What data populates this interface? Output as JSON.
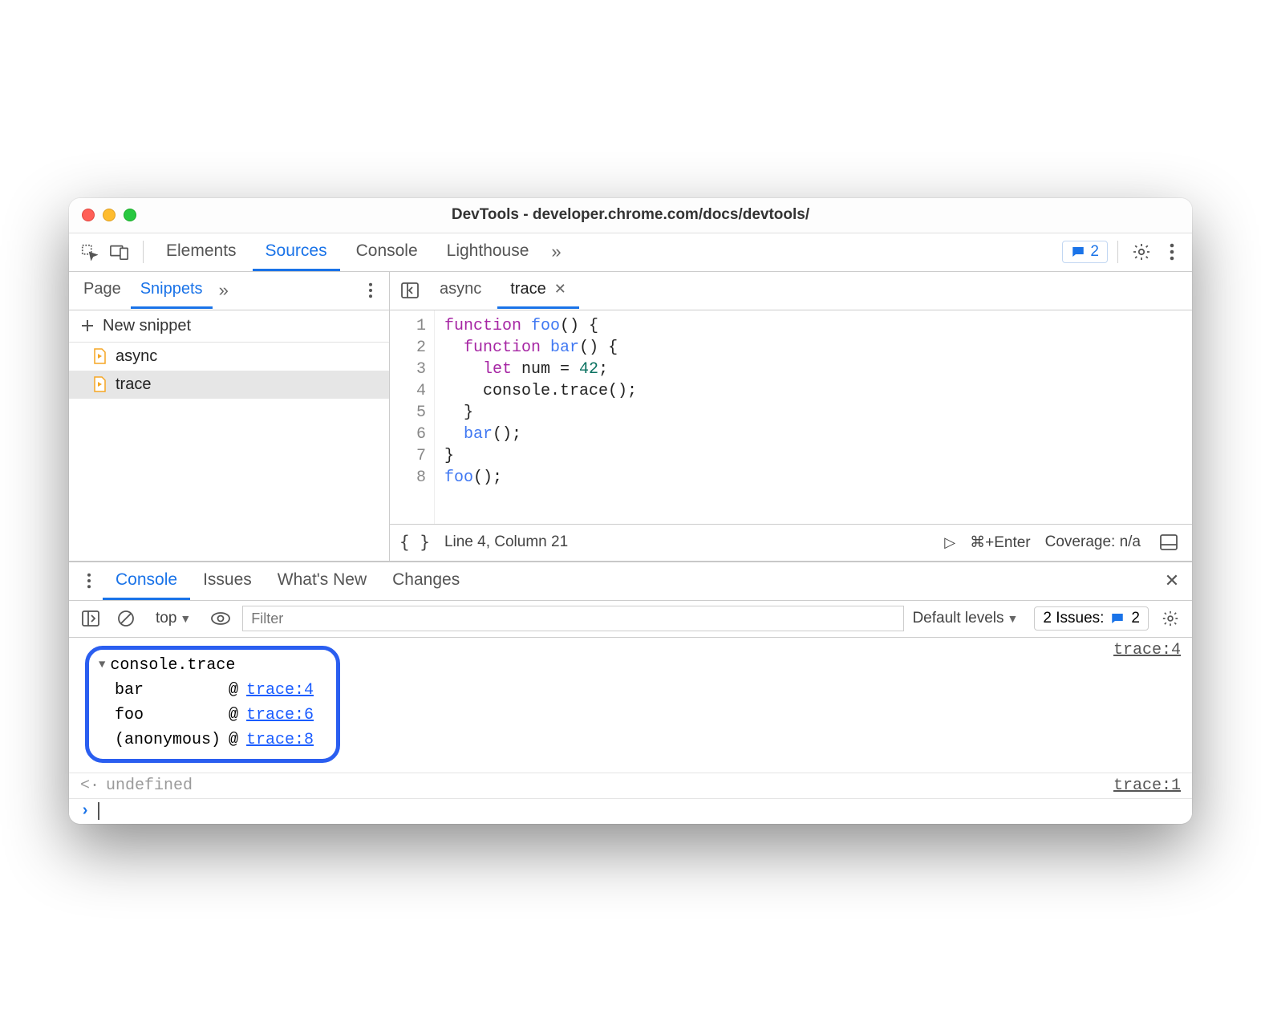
{
  "window": {
    "title": "DevTools - developer.chrome.com/docs/devtools/"
  },
  "toolbar": {
    "tabs": [
      "Elements",
      "Sources",
      "Console",
      "Lighthouse"
    ],
    "active_tab": "Sources",
    "issues_badge_count": "2"
  },
  "sidebar": {
    "tabs": [
      "Page",
      "Snippets"
    ],
    "active_tab": "Snippets",
    "new_snippet_label": "New snippet",
    "snippets": [
      {
        "name": "async",
        "selected": false
      },
      {
        "name": "trace",
        "selected": true
      }
    ]
  },
  "editor": {
    "tabs": [
      {
        "name": "async",
        "active": false,
        "closeable": false
      },
      {
        "name": "trace",
        "active": true,
        "closeable": true
      }
    ],
    "lines": [
      1,
      2,
      3,
      4,
      5,
      6,
      7,
      8
    ],
    "code_tokens": [
      [
        {
          "t": "kw",
          "s": "function"
        },
        {
          "t": "",
          "s": " "
        },
        {
          "t": "name",
          "s": "foo"
        },
        {
          "t": "",
          "s": "() {"
        }
      ],
      [
        {
          "t": "",
          "s": "  "
        },
        {
          "t": "kw",
          "s": "function"
        },
        {
          "t": "",
          "s": " "
        },
        {
          "t": "name",
          "s": "bar"
        },
        {
          "t": "",
          "s": "() {"
        }
      ],
      [
        {
          "t": "",
          "s": "    "
        },
        {
          "t": "kw",
          "s": "let"
        },
        {
          "t": "",
          "s": " num = "
        },
        {
          "t": "num",
          "s": "42"
        },
        {
          "t": "",
          "s": ";"
        }
      ],
      [
        {
          "t": "",
          "s": "    console.trace();"
        }
      ],
      [
        {
          "t": "",
          "s": "  }"
        }
      ],
      [
        {
          "t": "",
          "s": "  "
        },
        {
          "t": "name",
          "s": "bar"
        },
        {
          "t": "",
          "s": "();"
        }
      ],
      [
        {
          "t": "",
          "s": "}"
        }
      ],
      [
        {
          "t": "name",
          "s": "foo"
        },
        {
          "t": "",
          "s": "();"
        }
      ]
    ],
    "status": {
      "brackets_icon": "{ }",
      "position": "Line 4, Column 21",
      "run_hint": "⌘+Enter",
      "coverage": "Coverage: n/a"
    }
  },
  "drawer": {
    "tabs": [
      "Console",
      "Issues",
      "What's New",
      "Changes"
    ],
    "active_tab": "Console",
    "toolbar": {
      "context": "top",
      "filter_placeholder": "Filter",
      "levels": "Default levels",
      "issues_label": "2 Issues:",
      "issues_count": "2"
    },
    "console": {
      "trace_header": "console.trace",
      "trace_source": "trace:4",
      "stack": [
        {
          "fn": "bar",
          "at": "@",
          "loc": "trace:4"
        },
        {
          "fn": "foo",
          "at": "@",
          "loc": "trace:6"
        },
        {
          "fn": "(anonymous)",
          "at": "@",
          "loc": "trace:8"
        }
      ],
      "return_row": {
        "arrow": "<·",
        "value": "undefined",
        "source": "trace:1"
      }
    }
  }
}
